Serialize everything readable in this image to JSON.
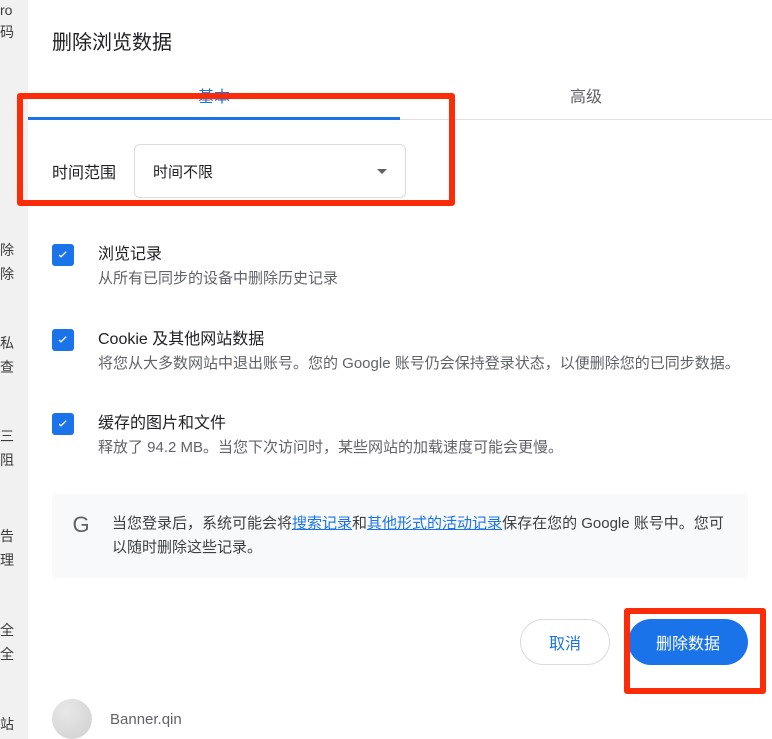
{
  "dialog_title": "删除浏览数据",
  "tabs": {
    "basic": "基本",
    "advanced": "高级"
  },
  "time": {
    "label": "时间范围",
    "selected": "时间不限"
  },
  "options": {
    "history": {
      "title": "浏览记录",
      "desc": "从所有已同步的设备中删除历史记录"
    },
    "cookies": {
      "title": "Cookie 及其他网站数据",
      "desc": "将您从大多数网站中退出账号。您的 Google 账号仍会保持登录状态，以便删除您的已同步数据。"
    },
    "cache": {
      "title": "缓存的图片和文件",
      "desc": "释放了 94.2 MB。当您下次访问时，某些网站的加载速度可能会更慢。"
    }
  },
  "info": {
    "g_letter": "G",
    "pre": "当您登录后，系统可能会将",
    "link1": "搜索记录",
    "mid1": "和",
    "link2": "其他形式的活动记录",
    "post": "保存在您的 Google 账号中。您可以随时删除这些记录。"
  },
  "buttons": {
    "cancel": "取消",
    "confirm": "删除数据"
  },
  "account": {
    "name": "Banner.qin"
  },
  "bg": {
    "f1": "ro",
    "f2": "码",
    "f3": "除",
    "f4": "除",
    "f5": "私",
    "f6": "查",
    "f7": "三",
    "f8": "阻",
    "f9": "告",
    "f10": "理",
    "f11": "全",
    "f12": "全",
    "f13": "站"
  }
}
